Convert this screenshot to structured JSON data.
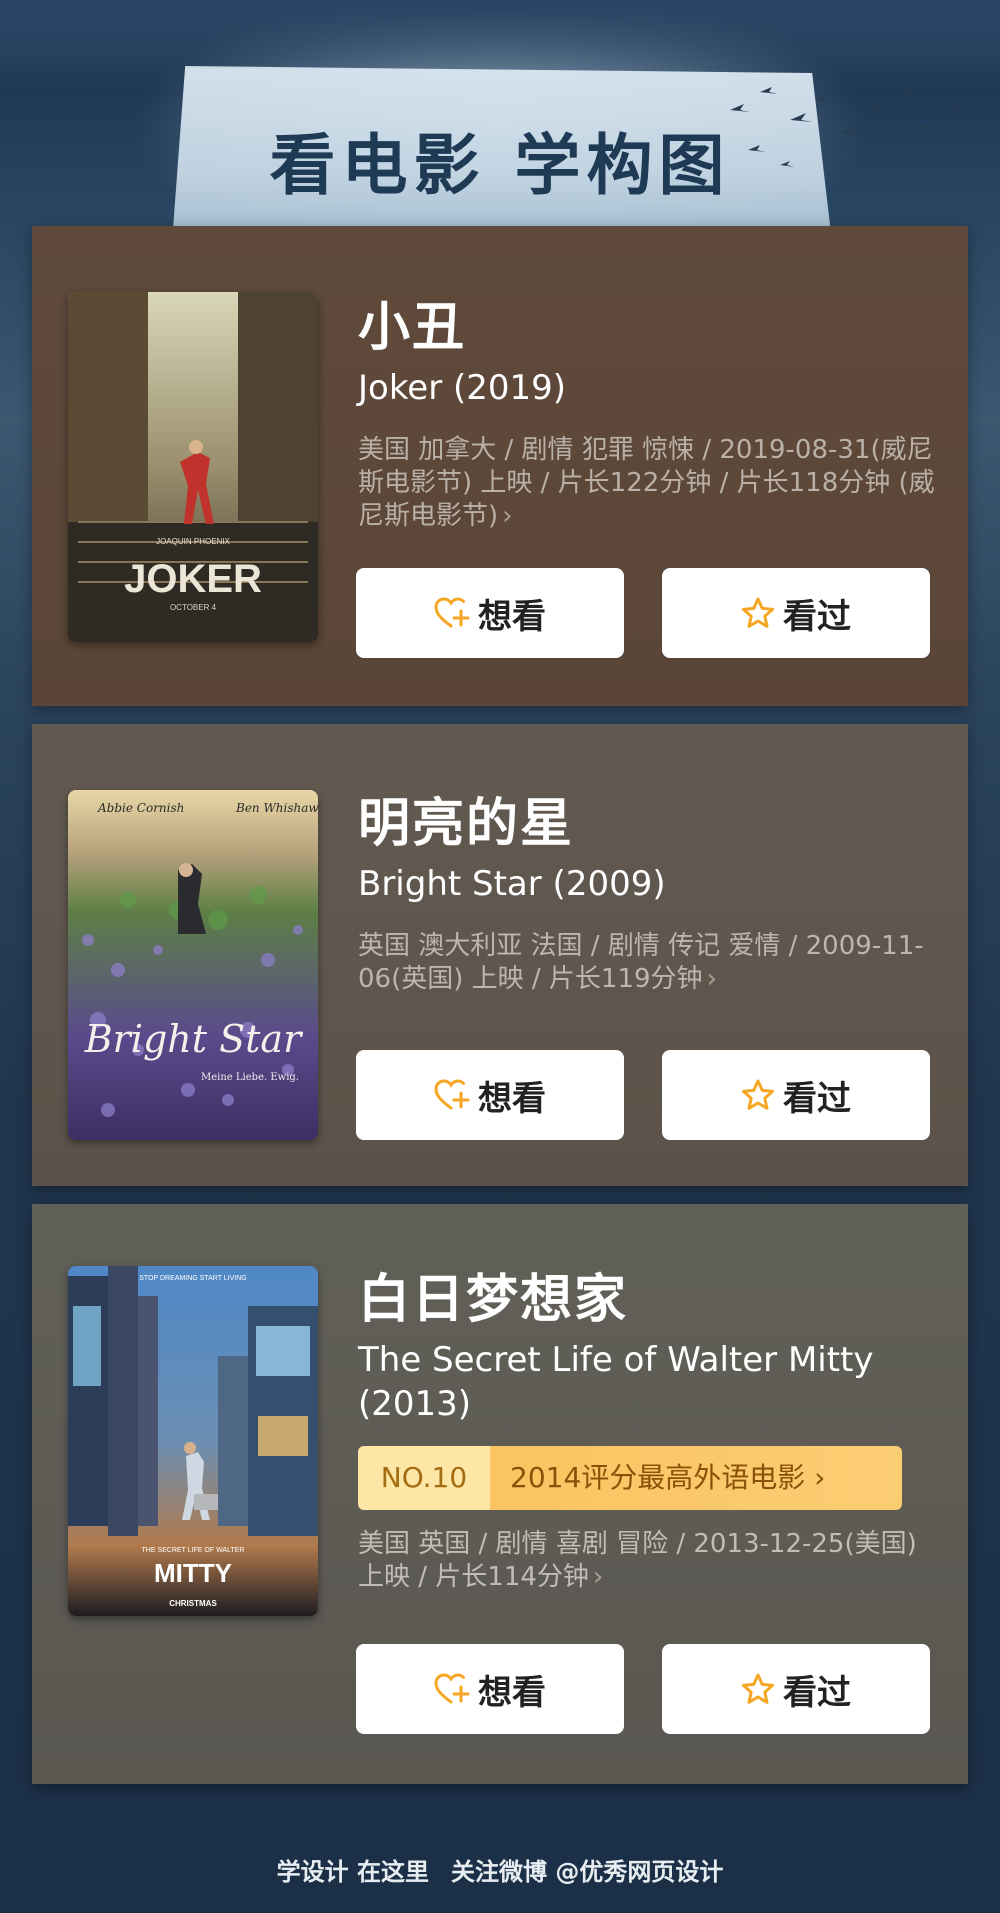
{
  "header": {
    "title": "看电影 学构图"
  },
  "movies": [
    {
      "title_cn": "小丑",
      "title_en": "Joker (2019)",
      "meta": "美国 加拿大 / 剧情 犯罪 惊悚 / 2019-08-31(威尼斯电影节) 上映 / 片长122分钟 / 片长118分钟 (威尼斯电影节)",
      "poster": {
        "credit": "JOAQUIN PHOENIX",
        "word": "JOKER",
        "date": "OCTOBER 4"
      },
      "want_label": "想看",
      "seen_label": "看过"
    },
    {
      "title_cn": "明亮的星",
      "title_en": "Bright Star (2009)",
      "meta": "英国 澳大利亚 法国 / 剧情 传记 爱情 / 2009-11-06(英国) 上映 / 片长119分钟",
      "poster": {
        "actor_left": "Abbie Cornish",
        "actor_right": "Ben Whishaw",
        "word": "Bright Star",
        "tagline": "Meine Liebe. Ewig."
      },
      "want_label": "想看",
      "seen_label": "看过"
    },
    {
      "title_cn": "白日梦想家",
      "title_en": "The Secret Life of Walter Mitty (2013)",
      "rank_no": "NO.10",
      "rank_text": "2014评分最高外语电影",
      "meta": "美国 英国 / 剧情 喜剧 冒险 / 2013-12-25(美国) 上映 / 片长114分钟",
      "poster": {
        "tagline": "STOP DREAMING START LIVING",
        "subtitle": "THE SECRET LIFE OF WALTER",
        "word": "MITTY",
        "release": "CHRISTMAS"
      },
      "want_label": "想看",
      "seen_label": "看过"
    }
  ],
  "footer": {
    "left": "学设计 在这里",
    "right": "关注微博 @优秀网页设计"
  },
  "colors": {
    "accent": "#f5a623",
    "rank_bg": "#f9c461"
  },
  "icons": {
    "want": "heart-plus-icon",
    "seen": "star-outline-icon",
    "chevron": "chevron-right-icon"
  }
}
